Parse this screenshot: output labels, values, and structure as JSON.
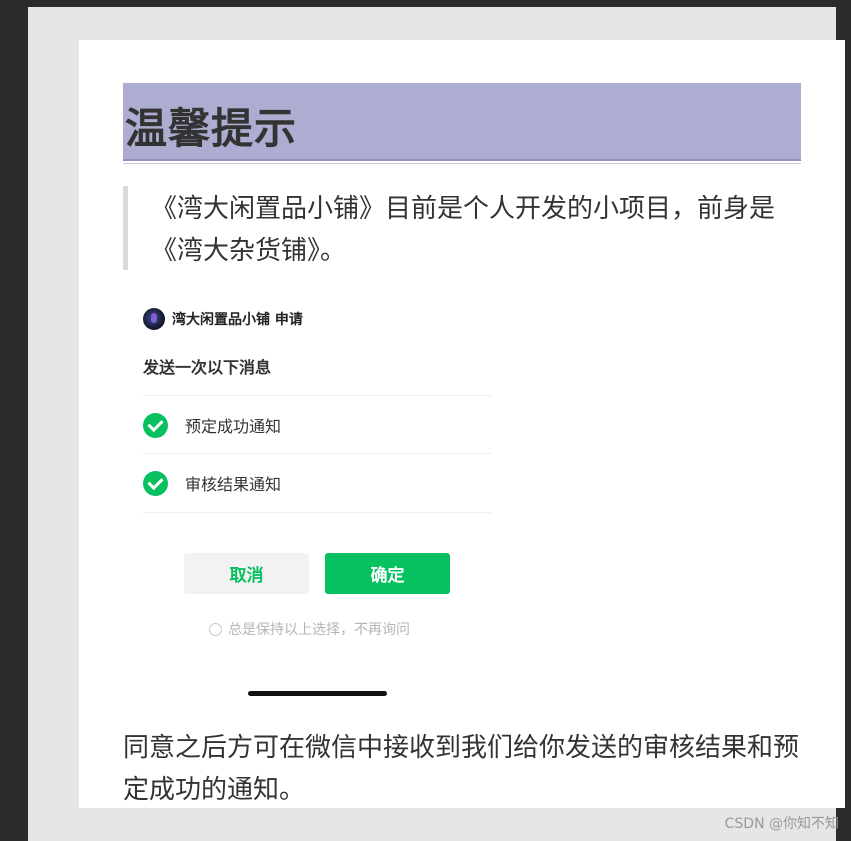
{
  "title": "温馨提示",
  "quote": "《湾大闲置品小铺》目前是个人开发的小项目，前身是《湾大杂货铺》。",
  "wechat_dialog": {
    "header": "湾大闲置品小铺 申请",
    "send_label": "发送一次以下消息",
    "items": [
      {
        "label": "预定成功通知",
        "icon": "check-circle-icon"
      },
      {
        "label": "审核结果通知",
        "icon": "check-circle-icon"
      }
    ],
    "cancel_label": "取消",
    "confirm_label": "确定",
    "keep_choice": "总是保持以上选择，不再询问"
  },
  "footer_text": "同意之后方可在微信中接收到我们给你发送的审核结果和预定成功的通知。",
  "watermark": "CSDN @你知不知",
  "colors": {
    "title_bar": "#acadd0",
    "wechat_green": "#07c160",
    "background": "#2b2b2b"
  }
}
